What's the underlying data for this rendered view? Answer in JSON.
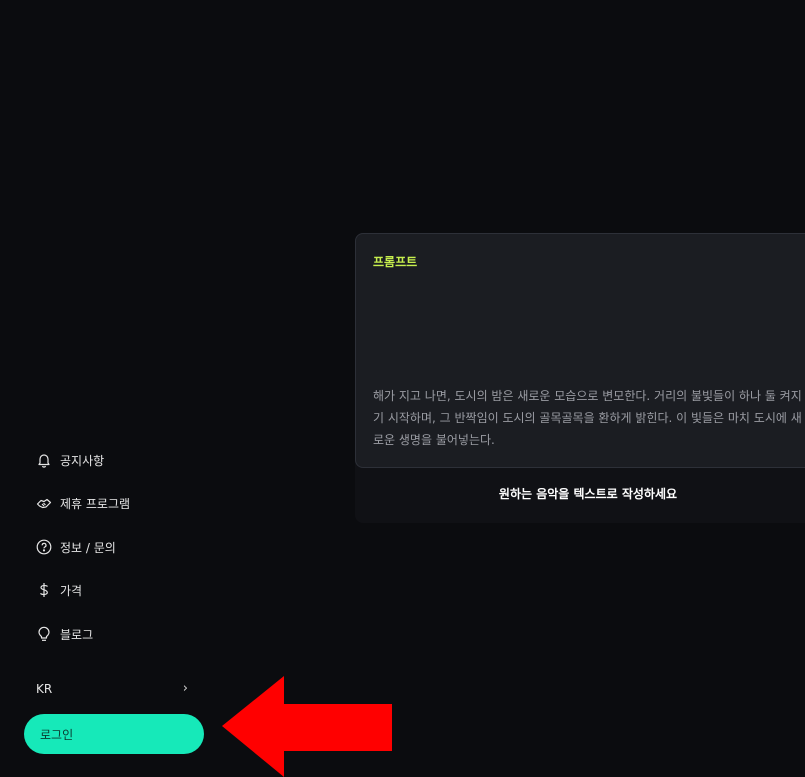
{
  "sidebar": {
    "items": [
      {
        "label": "공지사항",
        "icon": "bell-icon"
      },
      {
        "label": "제휴 프로그램",
        "icon": "handshake-icon"
      },
      {
        "label": "정보 / 문의",
        "icon": "question-circle-icon"
      },
      {
        "label": "가격",
        "icon": "dollar-icon"
      },
      {
        "label": "블로그",
        "icon": "lightbulb-icon"
      }
    ],
    "language": "KR",
    "language_chevron": "›",
    "login_label": "로그인"
  },
  "prompt": {
    "label": "프롬프트",
    "text": "해가 지고 나면, 도시의 밤은 새로운 모습으로 변모한다. 거리의 불빛들이 하나 둘 켜지기 시작하며, 그 반짝임이 도시의 골목골목을 환하게 밝힌다. 이 빛들은 마치 도시에 새로운 생명을 불어넣는다.",
    "hint": "원하는 음악을 텍스트로 작성하세요"
  },
  "colors": {
    "background": "#0b0c0f",
    "accent": "#16e9b9",
    "prompt_label": "#c7ef4e",
    "annotation_arrow": "#ff0000"
  }
}
